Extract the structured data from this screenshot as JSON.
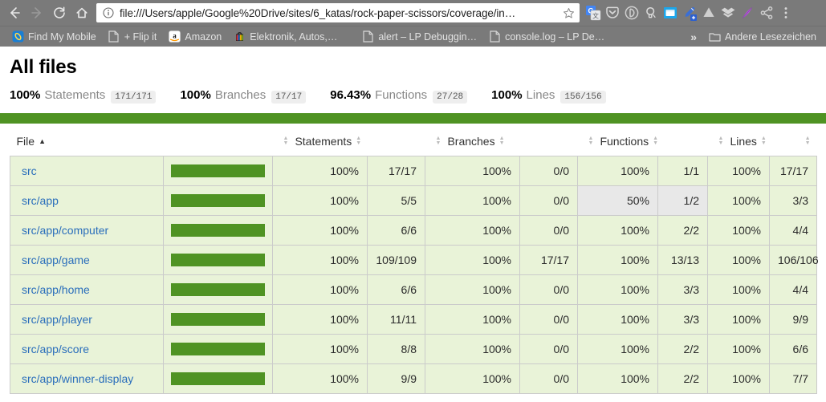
{
  "browser": {
    "nav": {
      "back": "back-arrow",
      "forward": "forward-arrow",
      "reload": "reload",
      "home": "home"
    },
    "omnibox": {
      "info_icon": "page-info-icon",
      "url": "file:///Users/apple/Google%20Drive/sites/6_katas/rock-paper-scissors/coverage/in…",
      "bookmark_star": "star-icon"
    },
    "extensions": [
      {
        "name": "google-translate-extension",
        "label": "G"
      },
      {
        "name": "pocket-extension",
        "label": ""
      },
      {
        "name": "circle-d-extension",
        "label": ""
      },
      {
        "name": "lightbulb-extension",
        "label": ""
      },
      {
        "name": "window-capture-extension",
        "label": ""
      },
      {
        "name": "color-picker-extension",
        "label": ""
      },
      {
        "name": "google-drive-extension",
        "label": ""
      },
      {
        "name": "dropbox-extension",
        "label": ""
      },
      {
        "name": "feather-pen-extension",
        "label": ""
      },
      {
        "name": "share-extension",
        "label": ""
      },
      {
        "name": "chrome-menu",
        "label": "⋮"
      }
    ],
    "bookmarks": [
      {
        "name": "bookmark-find-my-mobile",
        "label": "Find My Mobile",
        "icon": "samsung-icon"
      },
      {
        "name": "bookmark-flip-it",
        "label": "+ Flip it",
        "icon": "page-icon"
      },
      {
        "name": "bookmark-amazon",
        "label": "Amazon",
        "icon": "amazon-icon"
      },
      {
        "name": "bookmark-elektronik",
        "label": "Elektronik, Autos,…",
        "icon": "ebay-icon"
      },
      {
        "name": "bookmark-alert-lp",
        "label": "alert – LP Debuggin…",
        "icon": "page-icon"
      },
      {
        "name": "bookmark-console-log",
        "label": "console.log – LP De…",
        "icon": "page-icon"
      }
    ],
    "bookmarks_overflow": "»",
    "other_bookmarks": {
      "label": "Andere Lesezeichen",
      "icon": "folder-icon"
    }
  },
  "report": {
    "title": "All files",
    "summary": [
      {
        "pct": "100%",
        "label": "Statements",
        "fraction": "171/171"
      },
      {
        "pct": "100%",
        "label": "Branches",
        "fraction": "17/17"
      },
      {
        "pct": "96.43%",
        "label": "Functions",
        "fraction": "27/28"
      },
      {
        "pct": "100%",
        "label": "Lines",
        "fraction": "156/156"
      }
    ],
    "status_color": "#4f9323",
    "columns": [
      {
        "key": "file",
        "label": "File",
        "sorted": "asc"
      },
      {
        "key": "bar",
        "label": "",
        "sorted": "none"
      },
      {
        "key": "stmt_pct",
        "label": "Statements",
        "sorted": "none"
      },
      {
        "key": "stmt_abs",
        "label": "",
        "sorted": "none"
      },
      {
        "key": "branch_pct",
        "label": "Branches",
        "sorted": "none"
      },
      {
        "key": "branch_abs",
        "label": "",
        "sorted": "none"
      },
      {
        "key": "func_pct",
        "label": "Functions",
        "sorted": "none"
      },
      {
        "key": "func_abs",
        "label": "",
        "sorted": "none"
      },
      {
        "key": "line_pct",
        "label": "Lines",
        "sorted": "none"
      },
      {
        "key": "line_abs",
        "label": "",
        "sorted": "none"
      }
    ],
    "rows": [
      {
        "file": "src",
        "bar_pct": 100,
        "stmt_pct": "100%",
        "stmt_abs": "17/17",
        "stmt_class": "high",
        "branch_pct": "100%",
        "branch_abs": "0/0",
        "branch_class": "high",
        "func_pct": "100%",
        "func_abs": "1/1",
        "func_class": "high",
        "line_pct": "100%",
        "line_abs": "17/17",
        "line_class": "high"
      },
      {
        "file": "src/app",
        "bar_pct": 100,
        "stmt_pct": "100%",
        "stmt_abs": "5/5",
        "stmt_class": "high",
        "branch_pct": "100%",
        "branch_abs": "0/0",
        "branch_class": "high",
        "func_pct": "50%",
        "func_abs": "1/2",
        "func_class": "medium",
        "line_pct": "100%",
        "line_abs": "3/3",
        "line_class": "high"
      },
      {
        "file": "src/app/computer",
        "bar_pct": 100,
        "stmt_pct": "100%",
        "stmt_abs": "6/6",
        "stmt_class": "high",
        "branch_pct": "100%",
        "branch_abs": "0/0",
        "branch_class": "high",
        "func_pct": "100%",
        "func_abs": "2/2",
        "func_class": "high",
        "line_pct": "100%",
        "line_abs": "4/4",
        "line_class": "high"
      },
      {
        "file": "src/app/game",
        "bar_pct": 100,
        "stmt_pct": "100%",
        "stmt_abs": "109/109",
        "stmt_class": "high",
        "branch_pct": "100%",
        "branch_abs": "17/17",
        "branch_class": "high",
        "func_pct": "100%",
        "func_abs": "13/13",
        "func_class": "high",
        "line_pct": "100%",
        "line_abs": "106/106",
        "line_class": "high"
      },
      {
        "file": "src/app/home",
        "bar_pct": 100,
        "stmt_pct": "100%",
        "stmt_abs": "6/6",
        "stmt_class": "high",
        "branch_pct": "100%",
        "branch_abs": "0/0",
        "branch_class": "high",
        "func_pct": "100%",
        "func_abs": "3/3",
        "func_class": "high",
        "line_pct": "100%",
        "line_abs": "4/4",
        "line_class": "high"
      },
      {
        "file": "src/app/player",
        "bar_pct": 100,
        "stmt_pct": "100%",
        "stmt_abs": "11/11",
        "stmt_class": "high",
        "branch_pct": "100%",
        "branch_abs": "0/0",
        "branch_class": "high",
        "func_pct": "100%",
        "func_abs": "3/3",
        "func_class": "high",
        "line_pct": "100%",
        "line_abs": "9/9",
        "line_class": "high"
      },
      {
        "file": "src/app/score",
        "bar_pct": 100,
        "stmt_pct": "100%",
        "stmt_abs": "8/8",
        "stmt_class": "high",
        "branch_pct": "100%",
        "branch_abs": "0/0",
        "branch_class": "high",
        "func_pct": "100%",
        "func_abs": "2/2",
        "func_class": "high",
        "line_pct": "100%",
        "line_abs": "6/6",
        "line_class": "high"
      },
      {
        "file": "src/app/winner-display",
        "bar_pct": 100,
        "stmt_pct": "100%",
        "stmt_abs": "9/9",
        "stmt_class": "high",
        "branch_pct": "100%",
        "branch_abs": "0/0",
        "branch_class": "high",
        "func_pct": "100%",
        "func_abs": "2/2",
        "func_class": "high",
        "line_pct": "100%",
        "line_abs": "7/7",
        "line_class": "high"
      }
    ]
  }
}
